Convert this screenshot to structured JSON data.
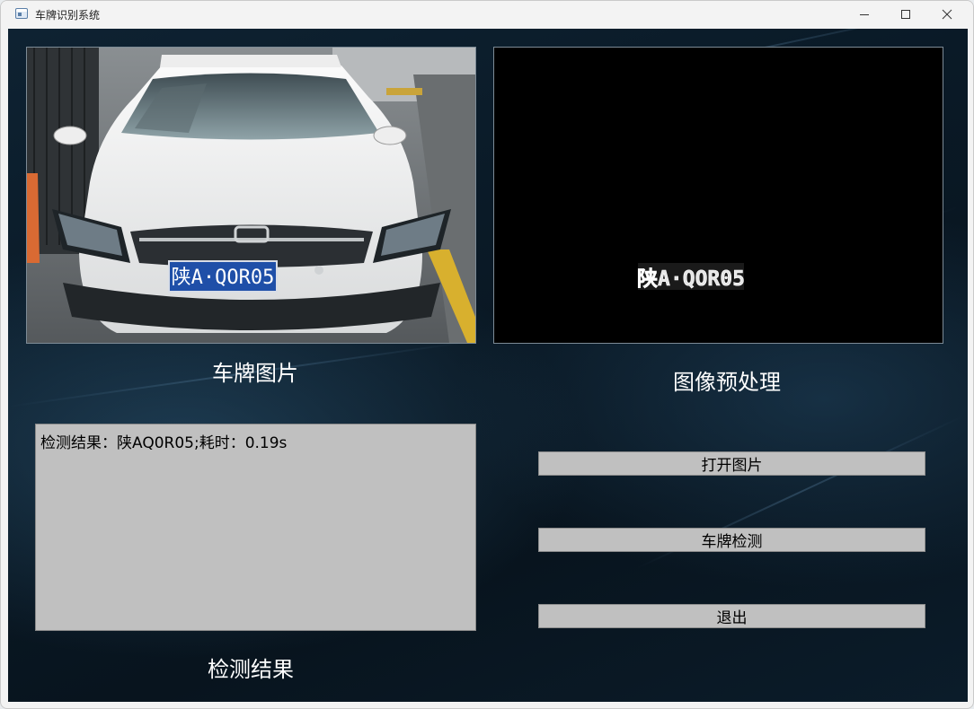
{
  "window": {
    "title": "车牌识别系统",
    "controls": {
      "minimize": "minimize-icon",
      "maximize": "maximize-icon",
      "close": "close-icon"
    }
  },
  "panels": {
    "plate_photo": {
      "caption": "车牌图片",
      "plate_text": "陕A·QOR05"
    },
    "preprocess": {
      "caption": "图像预处理",
      "plate_text": "陕A·QOR05"
    }
  },
  "result": {
    "caption": "检测结果",
    "text": "检测结果：陕AQ0R05;耗时：0.19s"
  },
  "buttons": {
    "open_image": "打开图片",
    "detect_plate": "车牌检测",
    "exit": "退出"
  },
  "colors": {
    "background": "#0a1a27",
    "panel_gray": "#c0c0c0",
    "plate_blue": "#1f4fa8"
  }
}
